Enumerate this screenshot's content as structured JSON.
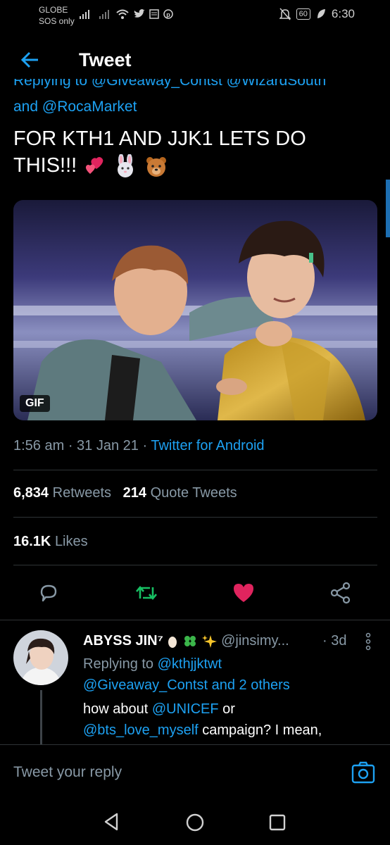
{
  "status_bar": {
    "carrier_line1": "GLOBE",
    "carrier_line2": "SOS only",
    "battery": "60",
    "time": "6:30"
  },
  "header": {
    "title": "Tweet"
  },
  "tweet": {
    "replying_cut": "Replying to @Giveaway_Contst @WizardSouth",
    "replying_and": "and",
    "replying_handle": "@RocaMarket",
    "text": "FOR KTH1 AND JJK1 LETS DO THIS!!!",
    "emojis": [
      "two-hearts-emoji",
      "rabbit-face-emoji",
      "bear-face-emoji"
    ],
    "media_badge": "GIF",
    "time": "1:56 am",
    "date": "31 Jan 21",
    "source": "Twitter for Android",
    "retweets_count": "6,834",
    "retweets_label": "Retweets",
    "quotes_count": "214",
    "quotes_label": "Quote Tweets",
    "likes_count": "16.1K",
    "likes_label": "Likes"
  },
  "reply": {
    "name": "ABYSS JIN⁷",
    "handle": "@jinsimy...",
    "time": "· 3d",
    "replying_prefix": "Replying to",
    "replying_user1": "@kthjjktwt",
    "replying_user2": "@Giveaway_Contst",
    "replying_suffix": "and 2 others",
    "body_part1": "how about",
    "body_mention1": "@UNICEF",
    "body_part2": "or",
    "body_mention2": "@bts_love_myself",
    "body_part3": "campaign? I mean,"
  },
  "composer": {
    "placeholder": "Tweet your reply"
  },
  "colors": {
    "accent": "#1da1f2",
    "like": "#e0245e",
    "retweet": "#17bf63",
    "muted": "#8899a6"
  }
}
